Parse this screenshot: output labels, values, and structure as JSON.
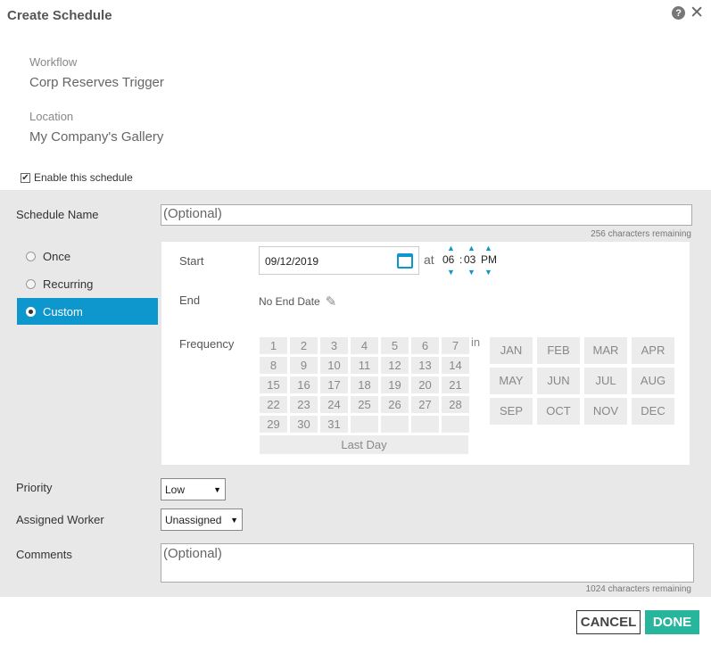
{
  "dialog": {
    "title": "Create Schedule",
    "help_icon": "?",
    "close_icon": "✕"
  },
  "info": {
    "workflow_label": "Workflow",
    "workflow_value": "Corp Reserves Trigger",
    "location_label": "Location",
    "location_value": "My Company's Gallery"
  },
  "enable": {
    "label": "Enable this schedule",
    "checked": true,
    "check_glyph": "✔"
  },
  "schedule_name": {
    "label": "Schedule Name",
    "placeholder": "(Optional)",
    "remaining": "256 characters remaining"
  },
  "schedule_type": {
    "options": [
      "Once",
      "Recurring",
      "Custom"
    ],
    "selected": "Custom"
  },
  "custom": {
    "start_label": "Start",
    "start_date": "09/12/2019",
    "at_label": "at",
    "hour": "06",
    "separator": ":",
    "minute": "03",
    "ampm": "PM",
    "end_label": "End",
    "end_value": "No End Date",
    "frequency_label": "Frequency",
    "days": [
      "1",
      "2",
      "3",
      "4",
      "5",
      "6",
      "7",
      "8",
      "9",
      "10",
      "11",
      "12",
      "13",
      "14",
      "15",
      "16",
      "17",
      "18",
      "19",
      "20",
      "21",
      "22",
      "23",
      "24",
      "25",
      "26",
      "27",
      "28",
      "29",
      "30",
      "31",
      "",
      "",
      "",
      ""
    ],
    "last_day_label": "Last Day",
    "in_label": "in",
    "months": [
      "JAN",
      "FEB",
      "MAR",
      "APR",
      "MAY",
      "JUN",
      "JUL",
      "AUG",
      "SEP",
      "OCT",
      "NOV",
      "DEC"
    ]
  },
  "priority": {
    "label": "Priority",
    "value": "Low"
  },
  "worker": {
    "label": "Assigned Worker",
    "value": "Unassigned"
  },
  "comments": {
    "label": "Comments",
    "placeholder": "(Optional)",
    "remaining": "1024 characters remaining"
  },
  "buttons": {
    "cancel": "CANCEL",
    "done": "DONE"
  },
  "colors": {
    "accent": "#0e97cc",
    "done": "#27b59b",
    "form_bg": "#e8e8e8"
  }
}
